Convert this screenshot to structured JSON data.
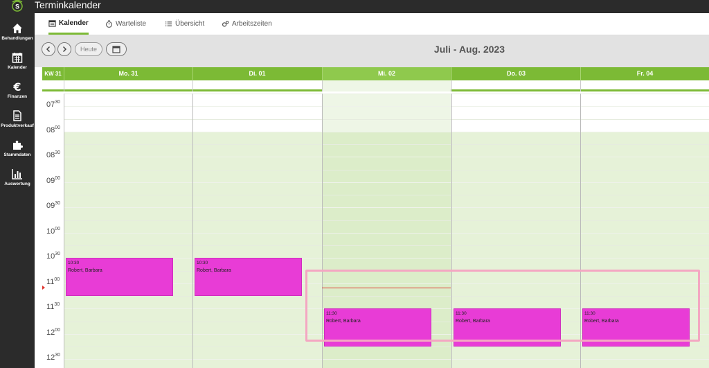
{
  "app": {
    "title": "Terminkalender",
    "logo_letter": "S"
  },
  "sidebar": {
    "items": [
      {
        "label": "Behandlungen",
        "icon": "home-icon"
      },
      {
        "label": "Kalender",
        "icon": "calendar-icon"
      },
      {
        "label": "Finanzen",
        "icon": "euro-icon"
      },
      {
        "label": "Produktverkauf",
        "icon": "document-icon"
      },
      {
        "label": "Stammdaten",
        "icon": "puzzle-icon"
      },
      {
        "label": "Auswertung",
        "icon": "bar-chart-icon"
      }
    ]
  },
  "tabs": [
    {
      "label": "Kalender",
      "icon": "calendar-icon",
      "active": true
    },
    {
      "label": "Warteliste",
      "icon": "stopwatch-icon",
      "active": false
    },
    {
      "label": "Übersicht",
      "icon": "list-icon",
      "active": false
    },
    {
      "label": "Arbeitszeiten",
      "icon": "gears-icon",
      "active": false
    }
  ],
  "toolbar": {
    "today_label": "Heute",
    "period": "Juli - Aug. 2023"
  },
  "calendar": {
    "week_label": "KW 31",
    "days": [
      "Mo. 31",
      "Di. 01",
      "Mi. 02",
      "Do. 03",
      "Fr. 04"
    ],
    "today_index": 2,
    "times": [
      {
        "h": "07",
        "m": "30"
      },
      {
        "h": "08",
        "m": "00"
      },
      {
        "h": "08",
        "m": "30"
      },
      {
        "h": "09",
        "m": "00"
      },
      {
        "h": "09",
        "m": "30"
      },
      {
        "h": "10",
        "m": "00"
      },
      {
        "h": "10",
        "m": "30"
      },
      {
        "h": "11",
        "m": "00"
      },
      {
        "h": "11",
        "m": "30"
      },
      {
        "h": "12",
        "m": "00"
      },
      {
        "h": "12",
        "m": "30"
      }
    ],
    "events": [
      {
        "day": 0,
        "start": "10:30",
        "end": "11:15",
        "time": "10:30",
        "name": "Robert, Barbara"
      },
      {
        "day": 1,
        "start": "10:30",
        "end": "11:15",
        "time": "10:30",
        "name": "Robert, Barbara"
      },
      {
        "day": 2,
        "start": "11:30",
        "end": "12:15",
        "time": "11:30",
        "name": "Robert, Barbara"
      },
      {
        "day": 3,
        "start": "11:30",
        "end": "12:15",
        "time": "11:30",
        "name": "Robert, Barbara"
      },
      {
        "day": 4,
        "start": "11:30",
        "end": "12:15",
        "time": "11:30",
        "name": "Robert, Barbara"
      }
    ],
    "now_time": "11:05",
    "colors": {
      "event": "#e83cd6",
      "header": "#7cba35",
      "now_line": "#e0342e",
      "highlight": "#f4a7c2"
    }
  }
}
